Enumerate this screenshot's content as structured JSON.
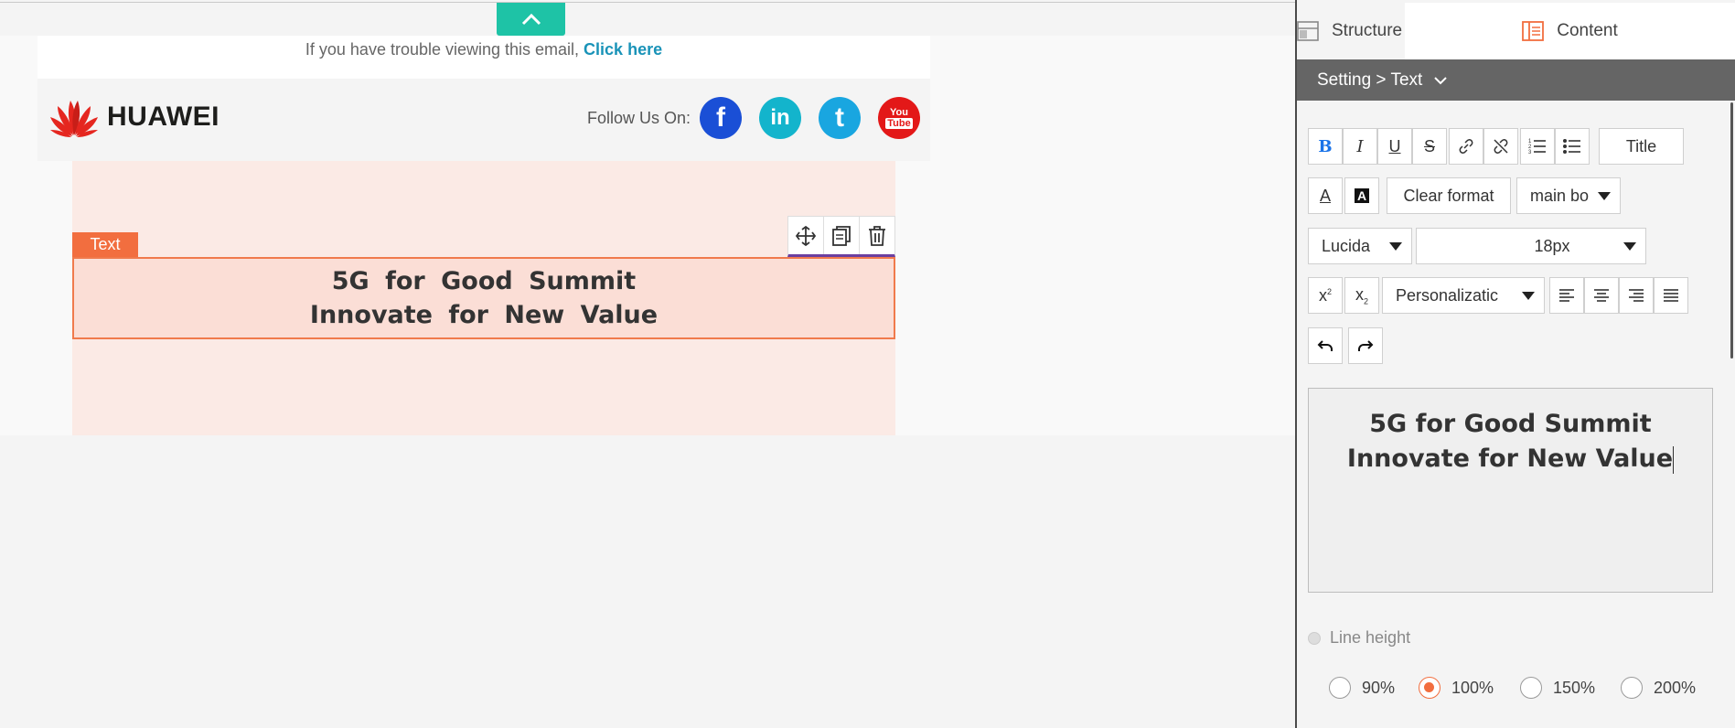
{
  "canvas": {
    "trouble_text": "If you have trouble viewing this email, ",
    "click_here": "Click here",
    "logo_text": "HUAWEI",
    "follow_label": "Follow Us On:",
    "social": {
      "facebook": "f",
      "linkedin": "in",
      "twitter": "t",
      "youtube_top": "You",
      "youtube_bottom": "Tube"
    },
    "block_tag": "Text",
    "block_line1": "5G for Good Summit",
    "block_line2": "Innovate for New Value"
  },
  "panel": {
    "tab_structure": "Structure",
    "tab_content": "Content",
    "breadcrumb": "Setting > Text",
    "toolbar": {
      "title_btn": "Title",
      "clear_format": "Clear format",
      "style_select": "main bo",
      "font_select": "Lucida",
      "size_select": "18px",
      "personalization_select": "Personalizatic"
    },
    "editor_line1": "5G for Good Summit",
    "editor_line2": "Innovate for New Value",
    "line_height_label": "Line height",
    "line_height_options": [
      "90%",
      "100%",
      "150%",
      "200%"
    ],
    "line_height_selected": "100%"
  },
  "colors": {
    "accent": "#f26e3f",
    "collapse_button": "#1ec3a6",
    "link": "#1a93b8",
    "setting_bar": "#656565"
  }
}
